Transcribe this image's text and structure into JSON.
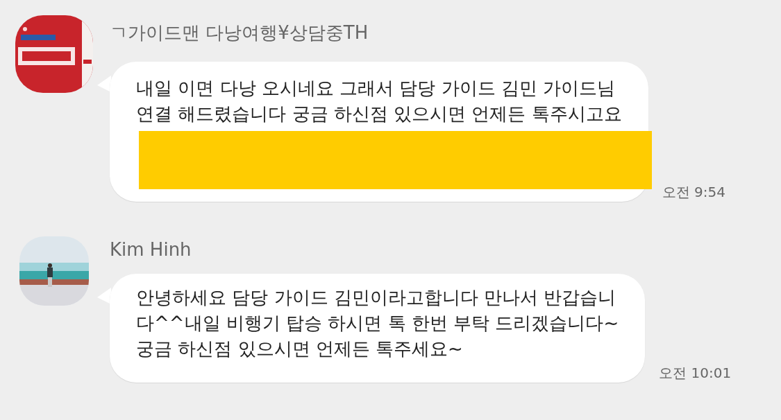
{
  "messages": [
    {
      "sender": "ㄱ가이드맨 다낭여행¥상담중TH",
      "avatar": {
        "kind": "logo"
      },
      "text": "내일 이면 다낭 오시네요 그래서 담당 가이드 김민 가이드님\n연결 해드렸습니다 궁금 하신점 있으시면 언제든 톡주시고요",
      "redacted": true,
      "time": "오전 9:54"
    },
    {
      "sender": "Kim Hinh",
      "text": "안녕하세요 담당 가이드 김민이라고합니다 만나서 반갑습니\n다^^내일 비행기 탑승 하시면 톡 한번 부탁 드리겠습니다~\n궁금 하신점 있으시면 언제든 톡주세요~",
      "time": "오전 10:01"
    }
  ]
}
